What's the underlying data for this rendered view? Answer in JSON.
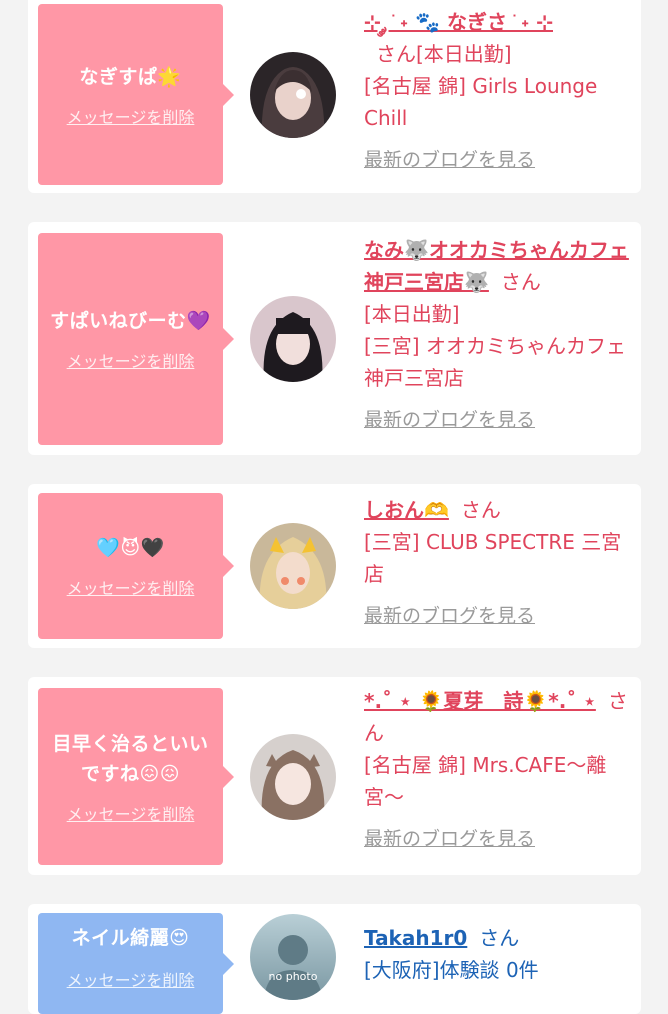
{
  "items": [
    {
      "message": "なぎすぱ🌟",
      "delete_label": "メッセージを削除",
      "name": "⊹ ༘ ֹ ˖ 🐾 なぎさ ֹ ˖ ⊹",
      "honorific": "さん",
      "status": "[本日出勤]",
      "shop": "[名古屋 錦] Girls Lounge Chill",
      "blog_label": "最新のブログを見る"
    },
    {
      "message": "すぱいねびーむ💜",
      "delete_label": "メッセージを削除",
      "name": "なみ🐺オオカミちゃんカフェ神戸三宮店🐺",
      "honorific": "さん",
      "status": "[本日出勤]",
      "shop": "[三宮] オオカミちゃんカフェ神戸三宮店",
      "blog_label": "最新のブログを見る"
    },
    {
      "message": "🩵😈🖤",
      "delete_label": "メッセージを削除",
      "name": "しおん🫶",
      "honorific": "さん",
      "shop": "[三宮] CLUB SPECTRE 三宮店",
      "blog_label": "最新のブログを見る"
    },
    {
      "message": "目早く治るといいですね😖😖",
      "delete_label": "メッセージを削除",
      "name": "*.˚ ⋆ 🌻夏芽　詩🌻*.˚ ⋆",
      "honorific": "さん",
      "shop": "[名古屋 錦] Mrs.CAFE〜離宮〜",
      "blog_label": "最新のブログを見る"
    },
    {
      "message": "ネイル綺麗😍",
      "delete_label": "メッセージを削除",
      "name": "Takah1r0",
      "honorific": "さん",
      "shop": "[大阪府]体験談 0件",
      "avatar_text": "no photo"
    }
  ]
}
